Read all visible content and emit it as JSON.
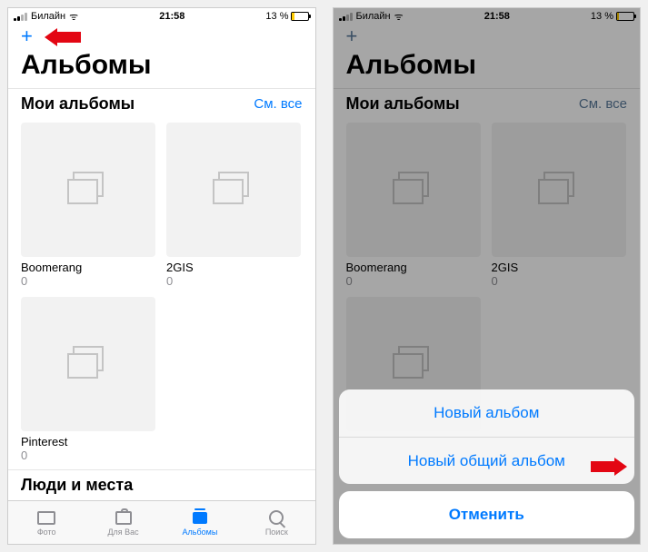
{
  "status": {
    "carrier": "Билайн",
    "time": "21:58",
    "battery_pct": "13 %"
  },
  "nav": {
    "plus": "+"
  },
  "header": {
    "title": "Альбомы"
  },
  "section_my": {
    "title": "Мои альбомы",
    "see_all": "См. все"
  },
  "albums": [
    {
      "name": "Boomerang",
      "count": "0"
    },
    {
      "name": "2GIS",
      "count": "0"
    },
    {
      "name": "Pinterest",
      "count": "0"
    }
  ],
  "section_places": {
    "title": "Люди и места"
  },
  "tabs": [
    {
      "label": "Фото"
    },
    {
      "label": "Для Вас"
    },
    {
      "label": "Альбомы"
    },
    {
      "label": "Поиск"
    }
  ],
  "sheet": {
    "new_album": "Новый альбом",
    "new_shared": "Новый общий альбом",
    "cancel": "Отменить"
  }
}
